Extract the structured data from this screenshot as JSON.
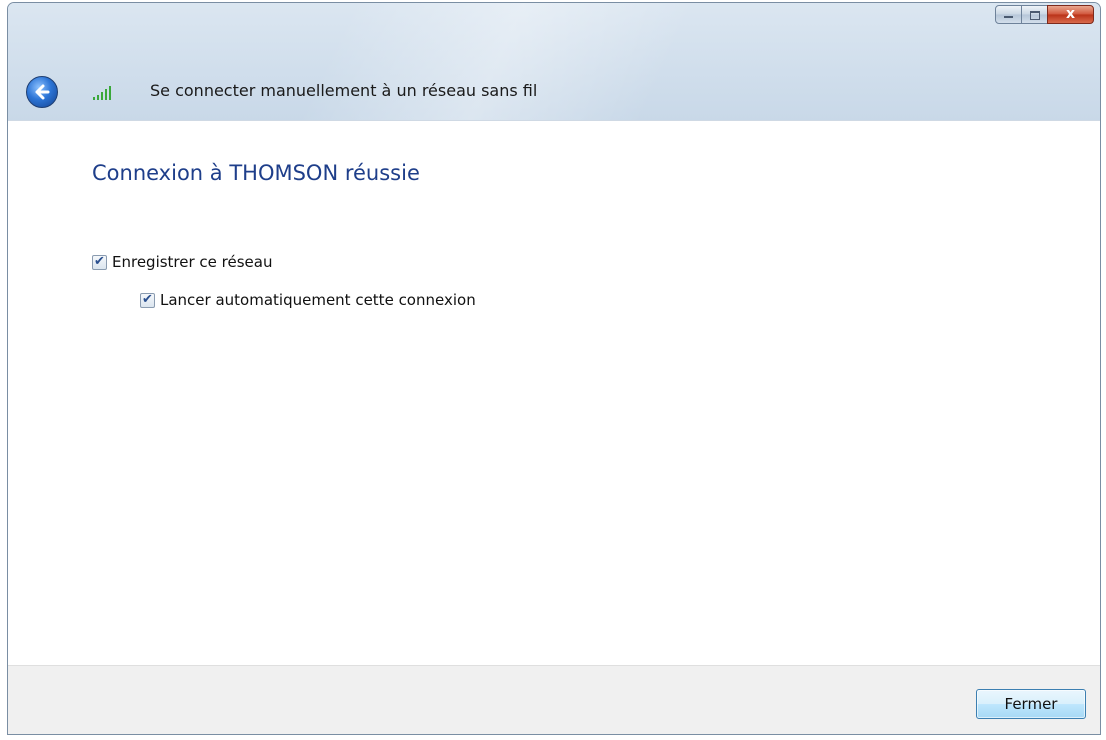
{
  "window": {
    "caption_buttons": {
      "close_glyph": "x"
    }
  },
  "nav": {
    "back_icon": "back-arrow-icon",
    "network_icon": "wireless-signal-icon",
    "title": "Se connecter manuellement à un réseau sans fil"
  },
  "main": {
    "heading": "Connexion à THOMSON réussie",
    "options": [
      {
        "label": "Enregistrer ce réseau",
        "checked": true
      },
      {
        "label": "Lancer automatiquement cette connexion",
        "checked": true
      }
    ],
    "check_glyph": "✔"
  },
  "footer": {
    "close_label": "Fermer"
  },
  "colors": {
    "heading": "#1e3e8a",
    "signal_green": "#3aa83a",
    "close_red": "#c8432a"
  }
}
